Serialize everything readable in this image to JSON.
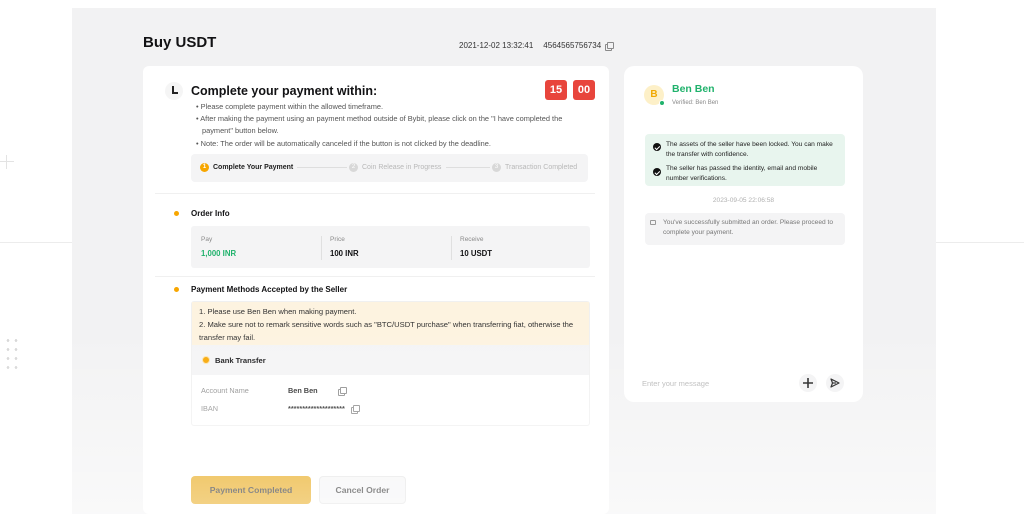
{
  "header": {
    "title": "Buy USDT",
    "datetime": "2021-12-02 13:32:41",
    "order_number": "4564565756734"
  },
  "payment": {
    "heading": "Complete your payment within:",
    "timer_minutes": "15",
    "timer_seconds": "00",
    "notes": [
      "• Please complete payment within the allowed timeframe.",
      "• After making the payment using an payment method outside of Bybit, please click on the \"I have completed the payment\" button below.",
      "• Note: The order will be automatically canceled if the button is not clicked by the deadline."
    ]
  },
  "steps": [
    {
      "num": "1",
      "label": "Complete Your Payment"
    },
    {
      "num": "2",
      "label": "Coin Release in Progress"
    },
    {
      "num": "3",
      "label": "Transaction Completed"
    }
  ],
  "order_info": {
    "title": "Order Info",
    "pay_label": "Pay",
    "pay_value": "1,000 INR",
    "price_label": "Price",
    "price_value": "100 INR",
    "receive_label": "Receive",
    "receive_value": "10 USDT"
  },
  "payment_methods": {
    "title": "Payment Methods Accepted by the Seller",
    "note_line1": "1. Please use Ben Ben when making payment.",
    "note_line2": "2. Make sure not to remark sensitive words such as \"BTC/USDT purchase\" when transferring fiat, otherwise the transfer may fail.",
    "method": "Bank Transfer",
    "account_name_label": "Account Name",
    "account_name_value": "Ben Ben",
    "iban_label": "IBAN",
    "iban_value": "********************"
  },
  "actions": {
    "primary": "Payment Completed",
    "secondary": "Cancel Order"
  },
  "chat": {
    "avatar_letter": "B",
    "seller_name": "Ben Ben",
    "verified": "Verified:  Ben Ben",
    "system_msg_1": "The assets of the seller have been locked. You can make the transfer with confidence.",
    "system_msg_2": "The seller has passed the identity, email and mobile number verifications.",
    "timestamp": "2023-09-05 22:06:58",
    "order_msg": "You've successfully submitted an order. Please proceed to complete your payment.",
    "input_placeholder": "Enter your message"
  },
  "colors": {
    "accent": "#f7a600",
    "green": "#20b26c",
    "timer_red": "#e8453c",
    "arrow_green": "#8fd6b0"
  },
  "icons": [
    "copy-icon",
    "clock-icon",
    "check-icon",
    "speaker-icon",
    "plus-icon",
    "send-icon",
    "arrow-icon"
  ]
}
